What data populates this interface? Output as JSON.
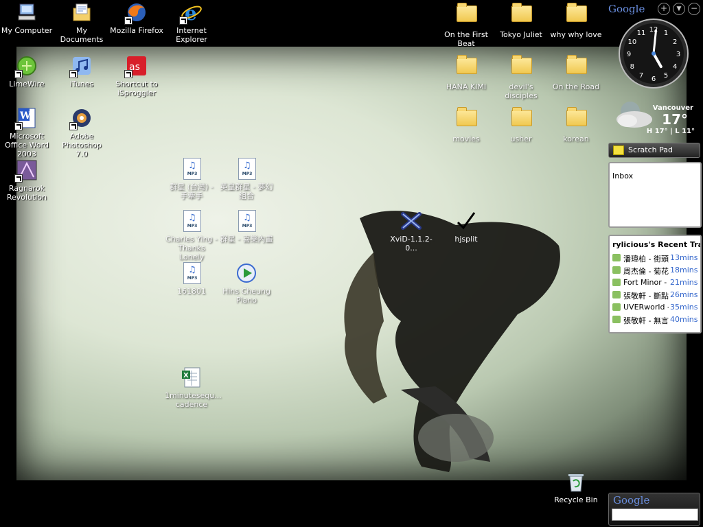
{
  "desktop": {
    "left_icons": [
      {
        "label": "My Computer",
        "icon": "my-computer-icon"
      },
      {
        "label": "My Documents",
        "icon": "my-documents-icon"
      },
      {
        "label": "Mozilla Firefox",
        "icon": "firefox-icon"
      },
      {
        "label": "Internet Explorer",
        "icon": "internet-explorer-icon"
      },
      {
        "label": "LimeWire",
        "icon": "limewire-icon"
      },
      {
        "label": "iTunes",
        "icon": "itunes-icon"
      },
      {
        "label": "Shortcut to iSproggler",
        "icon": "isproggler-icon"
      },
      {
        "label": "Microsoft Office Word 2003",
        "icon": "word-icon"
      },
      {
        "label": "Adobe Photoshop 7.0",
        "icon": "photoshop-icon"
      },
      {
        "label": "Ragnarok Revolution",
        "icon": "ragnarok-icon"
      }
    ],
    "mp3_files": [
      {
        "label": "群星 (台灣) - 手牽手"
      },
      {
        "label": "英皇群星 - 夢幻組合"
      },
      {
        "label": "Charles Ying - Thanks Lonely"
      },
      {
        "label": "群星 - 喜樂內畫"
      },
      {
        "label": "161801"
      }
    ],
    "other_files": [
      {
        "label": "Hins Cheung Piano"
      },
      {
        "label": "1minutesequ... cadence"
      },
      {
        "label": "XviD-1.1.2-0..."
      },
      {
        "label": "hjsplit"
      }
    ],
    "folders": [
      {
        "label": "On the First Beat"
      },
      {
        "label": "Tokyo Juliet"
      },
      {
        "label": "why why love"
      },
      {
        "label": "HANA KIMI"
      },
      {
        "label": "devil's disciples"
      },
      {
        "label": "On the Road"
      },
      {
        "label": "movies"
      },
      {
        "label": "usher"
      },
      {
        "label": "korean"
      }
    ],
    "recycle_bin": {
      "label": "Recycle Bin"
    }
  },
  "sidebar": {
    "header_logo": "Google",
    "clock": {
      "numbers": [
        "12",
        "1",
        "2",
        "3",
        "4",
        "5",
        "6",
        "7",
        "8",
        "9",
        "10",
        "11"
      ],
      "hour": 5,
      "minute": 1
    },
    "weather": {
      "city": "Vancouver",
      "temp": "17°",
      "range": "H 17° | L 11°"
    },
    "scratch_pad": {
      "title": "Scratch Pad"
    },
    "inbox": {
      "label": "Inbox"
    },
    "recent_tracks": {
      "title": "rylicious's Recent Tra",
      "items": [
        {
          "artist": "潘瑋柏 - 街頭",
          "time": "13mins"
        },
        {
          "artist": "周杰倫 - 菊花",
          "time": "18mins"
        },
        {
          "artist": "Fort Minor - B",
          "time": "21mins"
        },
        {
          "artist": "張敬軒 - 斷點",
          "time": "26mins"
        },
        {
          "artist": "UVERworld - D",
          "time": "35mins"
        },
        {
          "artist": "張敬軒 - 無言",
          "time": "40mins"
        }
      ]
    },
    "search_gadget": {
      "logo": "Google",
      "value": ""
    }
  },
  "colors": {
    "link_blue": "#3366cc",
    "sidebar_bg": "#000000"
  }
}
